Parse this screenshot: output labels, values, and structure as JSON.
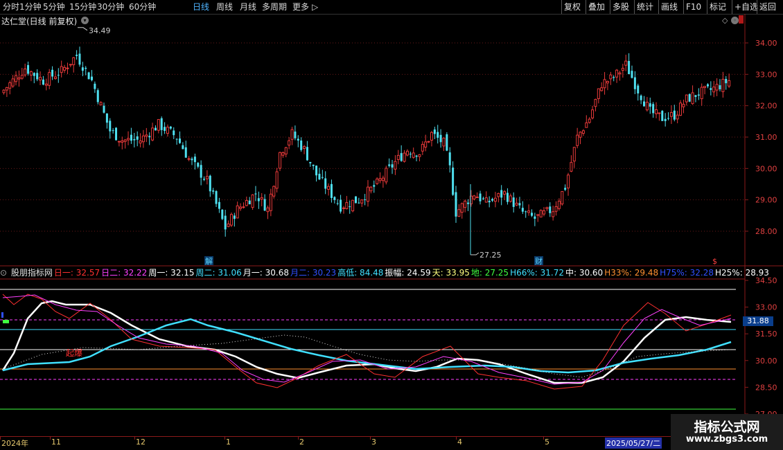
{
  "toolbar": {
    "periods": [
      "分时",
      "1分钟",
      "5分钟",
      "15分钟",
      "30分钟",
      "60分钟",
      "日线",
      "周线",
      "月线",
      "多周期",
      "更多"
    ],
    "active_period": "日线",
    "actions": [
      "复权",
      "叠加",
      "多股",
      "统计",
      "画线",
      "F10",
      "标记",
      "+自选",
      "返回"
    ]
  },
  "main_chart": {
    "title": "达仁堂(日线 前复权)",
    "high_label": "34.49",
    "low_label": "27.25",
    "y_ticks": [
      "34.00",
      "33.00",
      "32.00",
      "31.00",
      "30.00",
      "29.00",
      "28.00"
    ],
    "markers": [
      {
        "text": "解",
        "color": "#5fd8ff"
      },
      {
        "text": "财",
        "color": "#5fd8ff"
      },
      {
        "text": "$",
        "color": "#ff4040"
      }
    ]
  },
  "indicator": {
    "name": "股朋指标网",
    "values": [
      {
        "label": "日一:",
        "value": "32.57",
        "color": "#ff3030"
      },
      {
        "label": "日二:",
        "value": "32.22",
        "color": "#ff40ff"
      },
      {
        "label": "周一:",
        "value": "32.15",
        "color": "#ffffff"
      },
      {
        "label": "周二:",
        "value": "31.06",
        "color": "#40e0ff"
      },
      {
        "label": "月一:",
        "value": "30.68",
        "color": "#ffffff"
      },
      {
        "label": "月二:",
        "value": "30.23",
        "color": "#3050ff"
      },
      {
        "label": "高低:",
        "value": "84.48",
        "color": "#40e0ff"
      },
      {
        "label": "振幅:",
        "value": "24.59",
        "color": "#ffffff"
      },
      {
        "label": "天:",
        "value": "33.95",
        "color": "#ffff80"
      },
      {
        "label": "地:",
        "value": "27.25",
        "color": "#40ff40"
      },
      {
        "label": "H66%:",
        "value": "31.72",
        "color": "#40e0ff"
      },
      {
        "label": "中:",
        "value": "30.60",
        "color": "#ffffff"
      },
      {
        "label": "H33%:",
        "value": "29.48",
        "color": "#ff9030"
      },
      {
        "label": "H75%:",
        "value": "32.28",
        "color": "#3050ff"
      },
      {
        "label": "H25%:",
        "value": "28.93",
        "color": "#ffffff"
      }
    ],
    "y_ticks": [
      "34.50",
      "33.00",
      "31.50",
      "30.00",
      "28.50",
      "27.00"
    ],
    "current_value": "31.88",
    "annotation": "起爆"
  },
  "date_axis": {
    "labels": [
      "2024年",
      "11",
      "12",
      "1",
      "2",
      "3",
      "4",
      "5"
    ],
    "current_date": "2025/05/27/二"
  },
  "brand": {
    "name": "指标公式网",
    "url": "www.zbgs3.com"
  }
}
